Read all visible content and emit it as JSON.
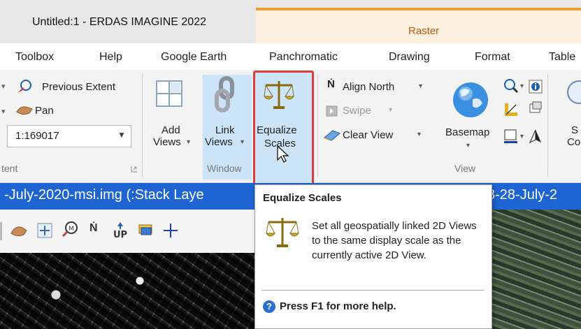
{
  "window": {
    "title": "Untitled:1 - ERDAS IMAGINE 2022"
  },
  "context_tab": {
    "label": "Raster",
    "color": "#c05a10",
    "band_color": "#fdf0de"
  },
  "tabs": [
    {
      "label": "Toolbox"
    },
    {
      "label": "Help"
    },
    {
      "label": "Google Earth"
    },
    {
      "label": "Panchromatic"
    },
    {
      "label": "Drawing"
    },
    {
      "label": "Format"
    },
    {
      "label": "Table"
    }
  ],
  "ribbon": {
    "previous_extent": "Previous Extent",
    "pan": "Pan",
    "scale_value": "1:169017",
    "extent_group": "tent",
    "add_views": {
      "line1": "Add",
      "line2": "Views"
    },
    "link_views": {
      "line1": "Link",
      "line2": "Views"
    },
    "equalize_scales": {
      "line1": "Equalize",
      "line2": "Scales"
    },
    "window_group": "Window",
    "align_north": "Align North",
    "swipe": "Swipe",
    "clear_view": "Clear View",
    "basemap": "Basemap",
    "view_group": "View",
    "s_line1": "S",
    "s_line2": "Co"
  },
  "viewer": {
    "title_left": "-July-2020-msi.img (:Stack Laye",
    "title_right": "8-28-July-2"
  },
  "tooltip": {
    "title": "Equalize Scales",
    "description": "Set all geospatially linked 2D Views to the same display scale as the currently active 2D View.",
    "help": "Press F1 for more help."
  },
  "colors": {
    "accent": "#1e64d2",
    "highlight_border": "#e03c3c",
    "selection": "#cce4f7"
  }
}
